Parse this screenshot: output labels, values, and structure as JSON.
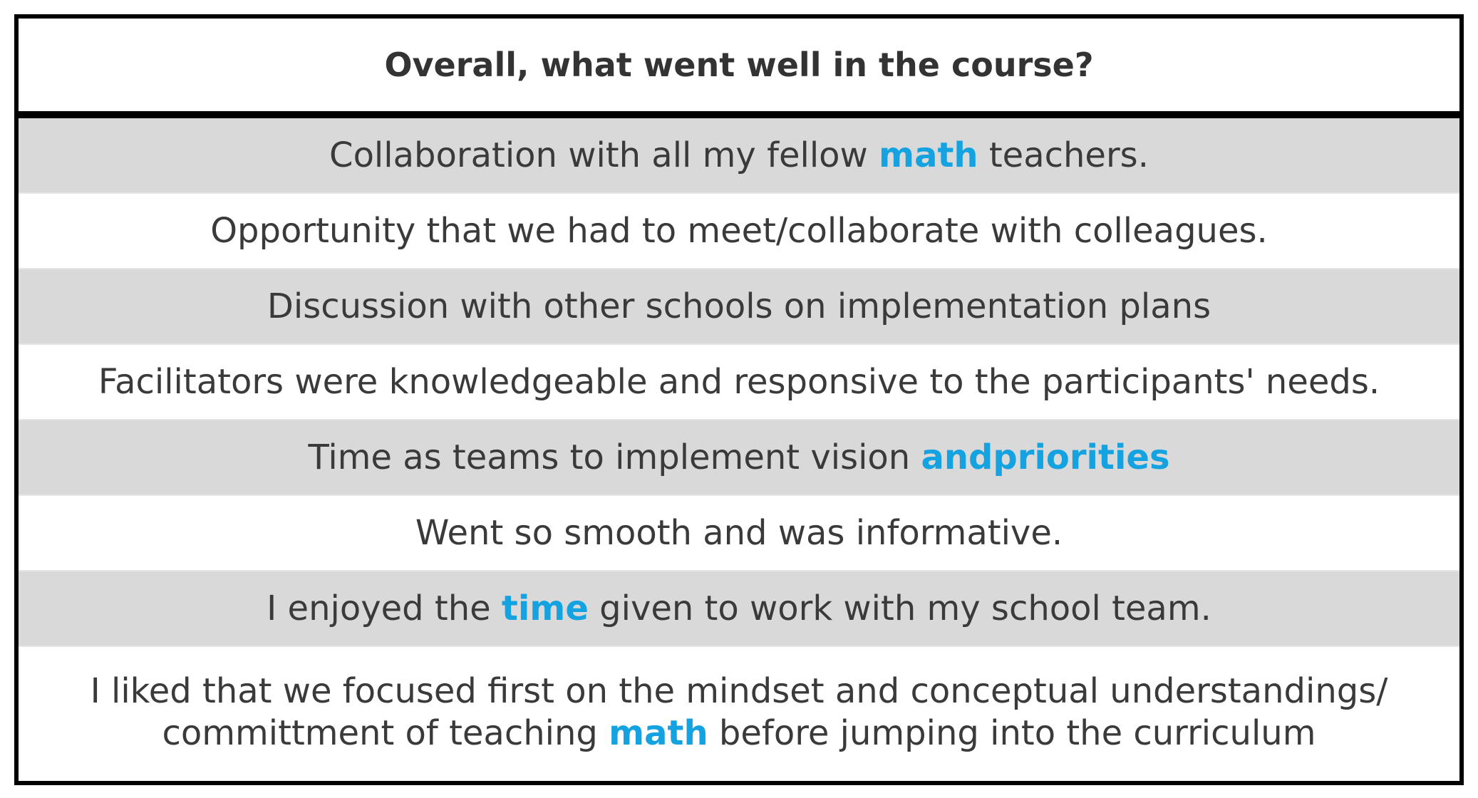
{
  "table": {
    "title": "Overall, what went well in the course?",
    "rows": [
      {
        "pre": "Collaboration with all my fellow ",
        "hl": "math",
        "post": " teachers."
      },
      {
        "pre": "Opportunity that we had to meet/collaborate with colleagues.",
        "hl": "",
        "post": ""
      },
      {
        "pre": "Discussion with other schools on implementation plans",
        "hl": "",
        "post": ""
      },
      {
        "pre": "Facilitators were knowledgeable and responsive to the participants' needs.",
        "hl": "",
        "post": ""
      },
      {
        "pre": "Time as teams to implement vision ",
        "hl": "andpriorities",
        "post": ""
      },
      {
        "pre": "Went so smooth and was informative.",
        "hl": "",
        "post": ""
      },
      {
        "pre": "I enjoyed the ",
        "hl": "time",
        "post": " given to work with my school team."
      }
    ],
    "last_row": {
      "line1": "I liked that we focused first on the mindset and conceptual understandings/",
      "line2_pre": "committment of teaching ",
      "line2_hl": "math",
      "line2_post": " before jumping into the curriculum"
    }
  },
  "colors": {
    "highlight": "#14a3e0",
    "stripe": "#d9d9d9",
    "border": "#000000",
    "text": "#3a3a3a"
  }
}
